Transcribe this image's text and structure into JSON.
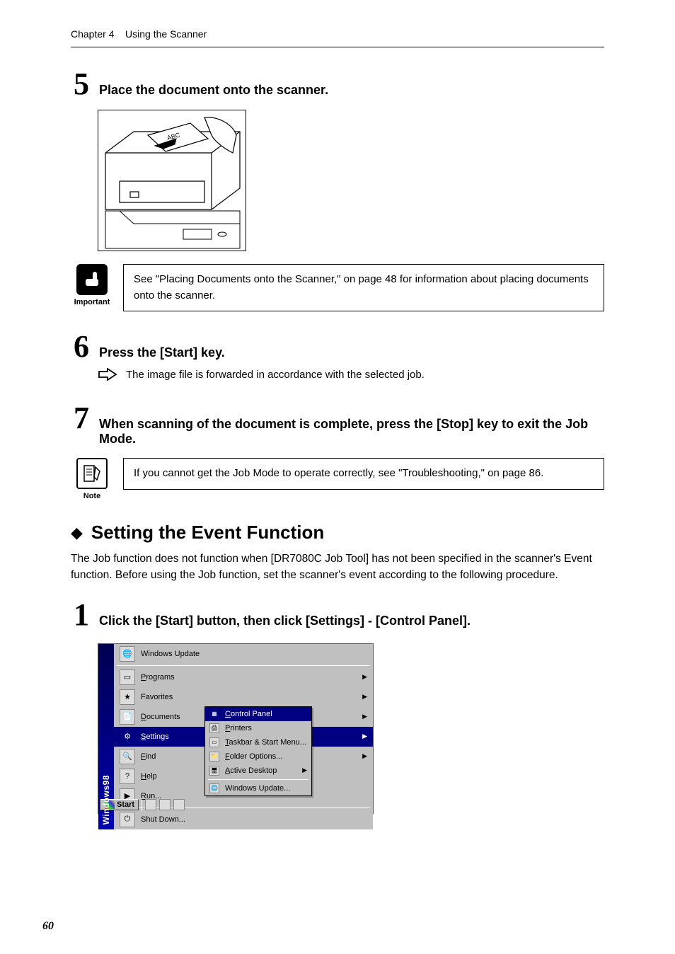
{
  "header": {
    "chapter": "Chapter 4",
    "title": "Using the Scanner"
  },
  "step5": {
    "num": "5",
    "title": "Place the document onto the scanner."
  },
  "important": {
    "label": "Important",
    "text": "See \"Placing Documents onto the Scanner,\" on page 48 for information about placing documents onto the scanner."
  },
  "step6": {
    "num": "6",
    "title": "Press the [Start] key.",
    "sub": "The image file is forwarded in accordance with the selected job."
  },
  "step7": {
    "num": "7",
    "title": "When scanning of the document is complete, press the [Stop] key to exit the Job Mode."
  },
  "note": {
    "label": "Note",
    "text": "If you cannot get the Job Mode to operate correctly, see \"Troubleshooting,\" on page 86."
  },
  "section": {
    "heading": "Setting the Event Function",
    "body": "The Job function does not function when [DR7080C Job Tool] has not been specified in the scanner's Event function. Before using the Job function, set the scanner's event according to the following procedure."
  },
  "step1": {
    "num": "1",
    "title": "Click the [Start] button, then click [Settings] - [Control Panel]."
  },
  "startmenu": {
    "stripe": "Windows98",
    "items": {
      "update": "Windows Update",
      "programs": "Programs",
      "favorites": "Favorites",
      "documents": "Documents",
      "settings": "Settings",
      "find": "Find",
      "help": "Help",
      "run": "Run...",
      "shutdown": "Shut Down..."
    },
    "sub": {
      "control": "Control Panel",
      "printers": "Printers",
      "taskbar": "Taskbar & Start Menu...",
      "folder": "Folder Options...",
      "active": "Active Desktop",
      "winupdate": "Windows Update..."
    },
    "startbtn": "Start"
  },
  "page_number": "60"
}
